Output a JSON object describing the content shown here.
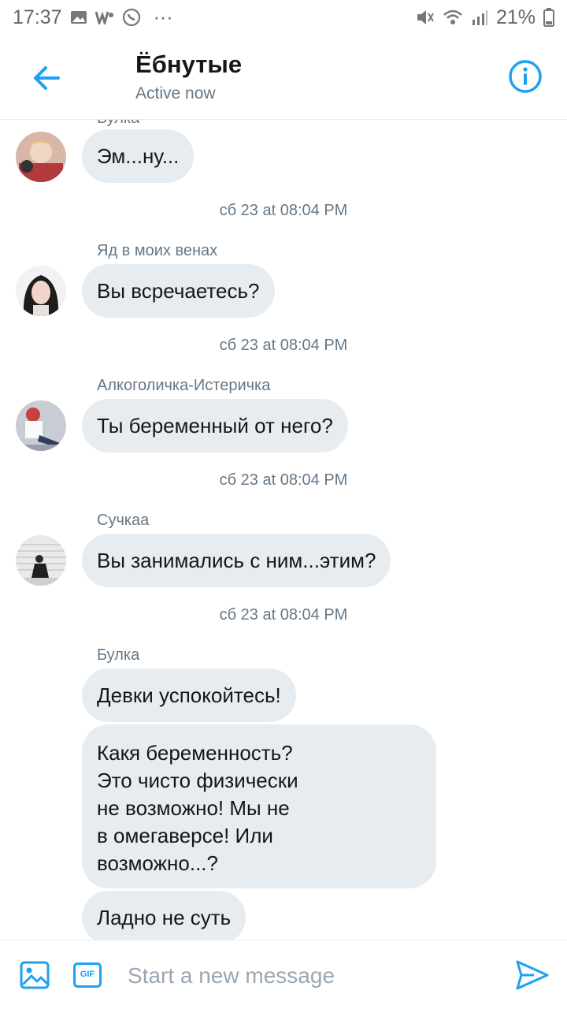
{
  "status_bar": {
    "time": "17:37",
    "battery": "21%",
    "more": "···"
  },
  "header": {
    "title": "Ёбнутые",
    "subtitle": "Active now"
  },
  "messages": {
    "top": {
      "sender_partial": "Булка",
      "text": "Эм...ну..."
    },
    "m1": {
      "sender": "Яд в моих венах",
      "text": "Вы всречаетесь?"
    },
    "m2": {
      "sender": "Алкоголичка-Истеричка",
      "text": "Ты беременный от него?"
    },
    "m3": {
      "sender": "Сучкаа",
      "text": "Вы занимались с ним...этим?"
    },
    "m4": {
      "sender": "Булка",
      "text1": "Девки успокойтесь!",
      "text2_lines": [
        "Какя беременность?",
        "Это чисто физически",
        "не возможно! Мы не",
        "в омегаверсе! Или",
        "возможно...?"
      ],
      "text3": "Ладно не суть"
    }
  },
  "timestamps": {
    "t1": "сб 23 at 08:04 PM",
    "t2": "сб 23 at 08:04 PM",
    "t3": "сб 23 at 08:04 PM",
    "t4": "сб 23 at 08:04 PM"
  },
  "composer": {
    "placeholder": "Start a new message",
    "gif_label": "GIF"
  },
  "colors": {
    "accent": "#1da1f2",
    "bubble": "#e6ecf0",
    "secondary_text": "#657786"
  },
  "icons": [
    "back-arrow-icon",
    "info-icon",
    "image-icon",
    "gif-icon",
    "send-icon"
  ]
}
